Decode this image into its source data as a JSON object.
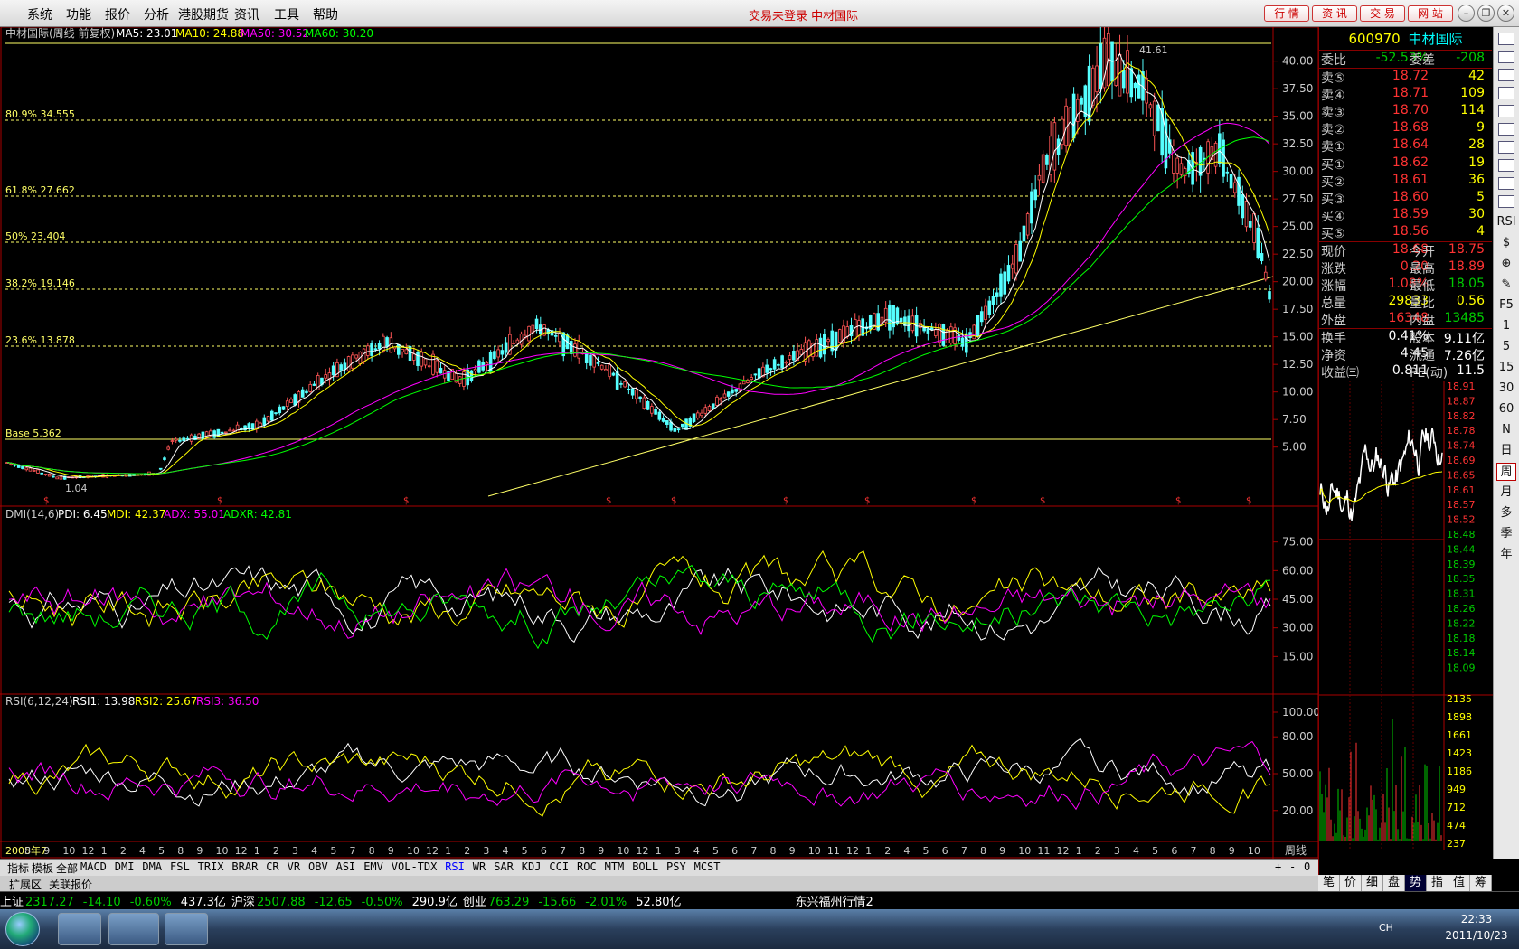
{
  "menubar": {
    "items": [
      "系统",
      "功能",
      "报价",
      "分析",
      "港股期货",
      "资讯",
      "工具",
      "帮助"
    ],
    "notice": "交易未登录  中材国际",
    "quick_buttons": [
      "行 情",
      "资 讯",
      "交 易",
      "网 站"
    ]
  },
  "chart": {
    "main_title": "中材国际(周线 前复权)",
    "ma": [
      {
        "label": "MA5: 23.01",
        "color": "#ffffff"
      },
      {
        "label": "MA10: 24.88",
        "color": "#ffff00"
      },
      {
        "label": "MA50: 30.52",
        "color": "#ff00ff"
      },
      {
        "label": "MA60: 30.20",
        "color": "#00ff00"
      }
    ],
    "fib": [
      {
        "label": "80.9% 34.555",
        "value": 34.555
      },
      {
        "label": "61.8% 27.662",
        "value": 27.662
      },
      {
        "label": "50% 23.404",
        "value": 23.404
      },
      {
        "label": "38.2% 19.146",
        "value": 19.146
      },
      {
        "label": "23.6% 13.878",
        "value": 13.878
      },
      {
        "label": "Base 5.362",
        "value": 5.362
      }
    ],
    "high_label": "41.61",
    "low_label": "1.04",
    "price_ticks": [
      "40.00",
      "37.50",
      "35.00",
      "32.50",
      "30.00",
      "27.50",
      "25.00",
      "22.50",
      "20.00",
      "17.50",
      "15.00",
      "12.50",
      "10.00",
      "7.50",
      "5.00"
    ],
    "dmi_title": "DMI(14,6)",
    "dmi": [
      {
        "label": "PDI: 6.45",
        "color": "#ffffff"
      },
      {
        "label": "MDI: 42.37",
        "color": "#ffff00"
      },
      {
        "label": "ADX: 55.01",
        "color": "#ff00ff"
      },
      {
        "label": "ADXR: 42.81",
        "color": "#00ff00"
      }
    ],
    "dmi_ticks": [
      "75.00",
      "60.00",
      "45.00",
      "30.00",
      "15.00"
    ],
    "rsi_title": "RSI(6,12,24)",
    "rsi": [
      {
        "label": "RSI1: 13.98",
        "color": "#ffffff"
      },
      {
        "label": "RSI2: 25.67",
        "color": "#ffff00"
      },
      {
        "label": "RSI3: 36.50",
        "color": "#ff00ff"
      }
    ],
    "rsi_ticks": [
      "100.00",
      "80.00",
      "50.00",
      "20.00"
    ],
    "x_labels": [
      "2005年7",
      "8",
      "9",
      "10",
      "12",
      "1",
      "2",
      "4",
      "5",
      "8",
      "9",
      "10",
      "12",
      "1",
      "2",
      "3",
      "4",
      "5",
      "7",
      "8",
      "9",
      "10",
      "12",
      "1",
      "2",
      "3",
      "4",
      "5",
      "6",
      "7",
      "8",
      "9",
      "10",
      "12",
      "1",
      "3",
      "4",
      "5",
      "6",
      "7",
      "8",
      "9",
      "10",
      "11",
      "12",
      "1",
      "2",
      "4",
      "5",
      "6",
      "7",
      "8",
      "9",
      "10",
      "11",
      "12",
      "1",
      "2",
      "3",
      "4",
      "5",
      "6",
      "7",
      "8",
      "9",
      "10"
    ],
    "period_label": "周线"
  },
  "quote": {
    "code": "600970",
    "name": "中材国际",
    "weibi_label": "委比",
    "weibi": "-52.53%",
    "weicha_label": "委差",
    "weicha": "-208",
    "asks": [
      {
        "label": "卖⑤",
        "price": "18.72",
        "vol": "42"
      },
      {
        "label": "卖④",
        "price": "18.71",
        "vol": "109"
      },
      {
        "label": "卖③",
        "price": "18.70",
        "vol": "114"
      },
      {
        "label": "卖②",
        "price": "18.68",
        "vol": "9"
      },
      {
        "label": "卖①",
        "price": "18.64",
        "vol": "28"
      }
    ],
    "bids": [
      {
        "label": "买①",
        "price": "18.62",
        "vol": "19"
      },
      {
        "label": "买②",
        "price": "18.61",
        "vol": "36"
      },
      {
        "label": "买③",
        "price": "18.60",
        "vol": "5"
      },
      {
        "label": "买④",
        "price": "18.59",
        "vol": "30"
      },
      {
        "label": "买⑤",
        "price": "18.56",
        "vol": "4"
      }
    ],
    "stats": [
      {
        "l1": "现价",
        "v1": "18.68",
        "c1": "#ff3333",
        "l2": "今开",
        "v2": "18.75",
        "c2": "#ff3333"
      },
      {
        "l1": "涨跌",
        "v1": "0.20",
        "c1": "#ff3333",
        "l2": "最高",
        "v2": "18.89",
        "c2": "#ff3333"
      },
      {
        "l1": "涨幅",
        "v1": "1.08%",
        "c1": "#ff3333",
        "l2": "最低",
        "v2": "18.05",
        "c2": "#00cc00"
      },
      {
        "l1": "总量",
        "v1": "29833",
        "c1": "#ffff00",
        "l2": "量比",
        "v2": "0.56",
        "c2": "#ffff00"
      },
      {
        "l1": "外盘",
        "v1": "16348",
        "c1": "#ff3333",
        "l2": "内盘",
        "v2": "13485",
        "c2": "#00cc00"
      }
    ],
    "fund": [
      {
        "l1": "换手",
        "v1": "0.41%",
        "l2": "股本",
        "v2": "9.11亿"
      },
      {
        "l1": "净资",
        "v1": "4.45",
        "l2": "流通",
        "v2": "7.26亿"
      },
      {
        "l1": "收益㈢",
        "v1": "0.811",
        "l2": "PE(动)",
        "v2": "11.5"
      }
    ],
    "intraday_ticks": [
      "18.91",
      "18.87",
      "18.82",
      "18.78",
      "18.74",
      "18.69",
      "18.65",
      "18.61",
      "18.57",
      "18.52",
      "18.48",
      "18.44",
      "18.39",
      "18.35",
      "18.31",
      "18.26",
      "18.22",
      "18.18",
      "18.14",
      "18.09"
    ],
    "vol_ticks": [
      "2135",
      "1898",
      "1661",
      "1423",
      "1186",
      "949",
      "712",
      "474",
      "237"
    ],
    "tabs": [
      "笔",
      "价",
      "细",
      "盘",
      "势",
      "指",
      "值",
      "筹"
    ],
    "active_tab": "势"
  },
  "sidebar": {
    "icons": [
      "grid-icon",
      "list-icon",
      "chart-icon",
      "bars-icon",
      "doc-icon",
      "f10-icon",
      "f1-icon",
      "f2-icon",
      "fn-icon",
      "search-icon"
    ],
    "labels": [
      "RSI",
      "$",
      "⊕",
      "✎",
      "F5",
      "1",
      "5",
      "15",
      "30",
      "60",
      "N",
      "日",
      "周",
      "月",
      "多",
      "季",
      "年"
    ],
    "active": "周"
  },
  "tabs": {
    "row1": [
      "指标",
      "模板",
      "全部",
      "MACD",
      "DMI",
      "DMA",
      "FSL",
      "TRIX",
      "BRAR",
      "CR",
      "VR",
      "OBV",
      "ASI",
      "EMV",
      "VOL-TDX",
      "RSI",
      "WR",
      "SAR",
      "KDJ",
      "CCI",
      "ROC",
      "MTM",
      "BOLL",
      "PSY",
      "MCST"
    ],
    "active": "RSI",
    "row2": [
      "扩展区",
      "关联报价"
    ],
    "controls": [
      "+",
      "-",
      "0"
    ]
  },
  "ticker": {
    "items": [
      {
        "name": "上证",
        "val": "2317.27",
        "chg": "-14.10",
        "pct": "-0.60%",
        "amt": "437.3亿"
      },
      {
        "name": "沪深",
        "val": "2507.88",
        "chg": "-12.65",
        "pct": "-0.50%",
        "amt": "290.9亿"
      },
      {
        "name": "创业",
        "val": "763.29",
        "chg": "-15.66",
        "pct": "-2.01%",
        "amt": "52.80亿"
      }
    ],
    "market": "东兴福州行情2"
  },
  "taskbar": {
    "lang": "CH",
    "time": "22:33",
    "date": "2011/10/23"
  },
  "colors": {
    "up": "#ff3333",
    "down": "#00ffff",
    "fib": "#ffff66",
    "axis": "#aa0000"
  }
}
